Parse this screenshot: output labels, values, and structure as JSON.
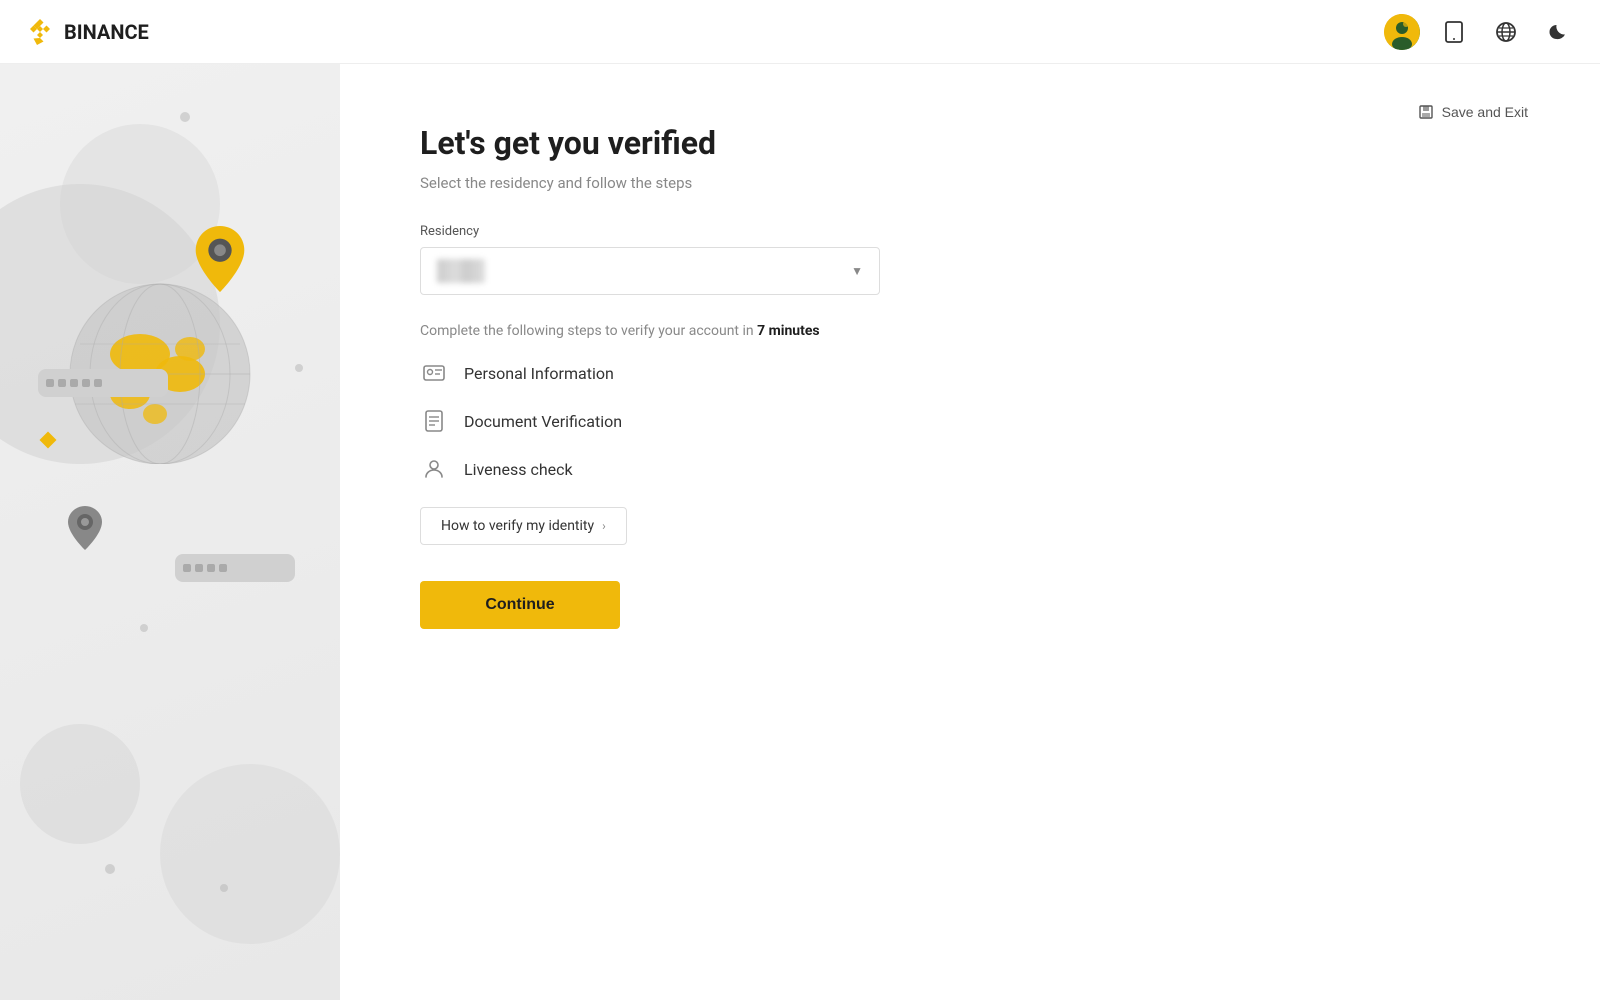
{
  "header": {
    "logo_text": "BINANCE"
  },
  "save_exit": {
    "label": "Save and Exit"
  },
  "main": {
    "title": "Let's get you verified",
    "subtitle": "Select the residency and follow the steps",
    "residency_label": "Residency",
    "residency_placeholder": "",
    "steps_intro": "Complete the following steps to verify your account in ",
    "steps_time": "7 minutes",
    "steps": [
      {
        "id": "personal-info",
        "label": "Personal Information",
        "icon": "id-card"
      },
      {
        "id": "doc-verify",
        "label": "Document Verification",
        "icon": "document"
      },
      {
        "id": "liveness",
        "label": "Liveness check",
        "icon": "person"
      }
    ],
    "verify_link_label": "How to verify my identity",
    "continue_label": "Continue"
  }
}
